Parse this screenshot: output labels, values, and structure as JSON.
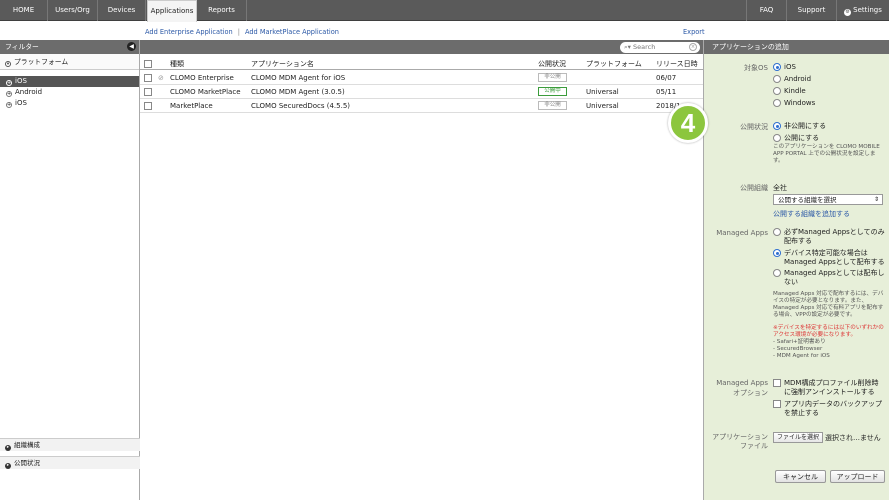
{
  "topnav": {
    "home": "HOME",
    "users": "Users/Org",
    "devices": "Devices",
    "applications": "Applications",
    "reports": "Reports",
    "faq": "FAQ",
    "support": "Support",
    "settings": "Settings"
  },
  "actions": {
    "add_enterprise": "Add Enterprise Application",
    "add_marketplace": "Add MarketPlace Application",
    "export": "Export"
  },
  "sidebar": {
    "header": "フィルター",
    "platform_section": "プラットフォーム",
    "items": [
      "iOS",
      "Android",
      "iOS"
    ],
    "bottom1": "組織構成",
    "bottom2": "公開状況"
  },
  "search": {
    "placeholder": "Search"
  },
  "table": {
    "headers": [
      "種類",
      "アプリケーション名",
      "公開状況",
      "プラットフォーム",
      "リリース日時"
    ],
    "rows": [
      {
        "type": "CLOMO Enterprise",
        "name": "CLOMO MDM Agent for iOS",
        "status": "非公開",
        "platform": "",
        "date": "06/07"
      },
      {
        "type": "CLOMO MarketPlace",
        "name": "CLOMO MDM Agent (3.0.5)",
        "status": "公開中",
        "platform": "Universal",
        "date": "05/11"
      },
      {
        "type": "MarketPlace",
        "name": "CLOMO SecuredDocs (4.5.5)",
        "status": "非公開",
        "platform": "Universal",
        "date": "2018/1"
      }
    ]
  },
  "panel": {
    "title": "アプリケーションの追加",
    "target_os_label": "対象OS",
    "os_options": [
      "iOS",
      "Android",
      "Kindle",
      "Windows"
    ],
    "publish_label": "公開状況",
    "publish_options": [
      "非公開にする",
      "公開にする"
    ],
    "publish_note": "このアプリケーションを CLOMO MOBILE APP PORTAL 上での公開状況を設定します。",
    "org_label": "公開組織",
    "org_value": "全社",
    "org_select": "公開する組織を選択",
    "org_add_link": "公開する組織を追加する",
    "managed_label": "Managed Apps",
    "managed_options": [
      "必ずManaged Appsとしてのみ配布する",
      "デバイス特定可能な場合はManaged Appsとして配布する",
      "Managed Appsとしては配布しない"
    ],
    "managed_note1": "Managed Apps 対応で配布するには、デバイスの特定が必要となります。また、Managed Apps 対応で有料アプリを配布する場合、VPPの設定が必要です。",
    "managed_note2": "※デバイスを特定するには以下のいずれかのアクセス環境が必要になります。",
    "managed_note3": "- Safari+証明書あり",
    "managed_note4": "- SecuredBrowser",
    "managed_note5": "- MDM Agent for iOS",
    "option_label1": "Managed Apps",
    "option_label2": "オプション",
    "option_items": [
      "MDM構成プロファイル削除時に強制アンインストールする",
      "アプリ内データのバックアップを禁止する"
    ],
    "file_label1": "アプリケーション",
    "file_label2": "ファイル",
    "file_button": "ファイルを選択",
    "file_status": "選択され…ません",
    "cancel": "キャンセル",
    "upload": "アップロード"
  },
  "step_number": "4",
  "colors": {
    "accent_green": "#8cc63e",
    "panel_bg": "#e7efd9",
    "topbar": "#5a5a5a"
  }
}
